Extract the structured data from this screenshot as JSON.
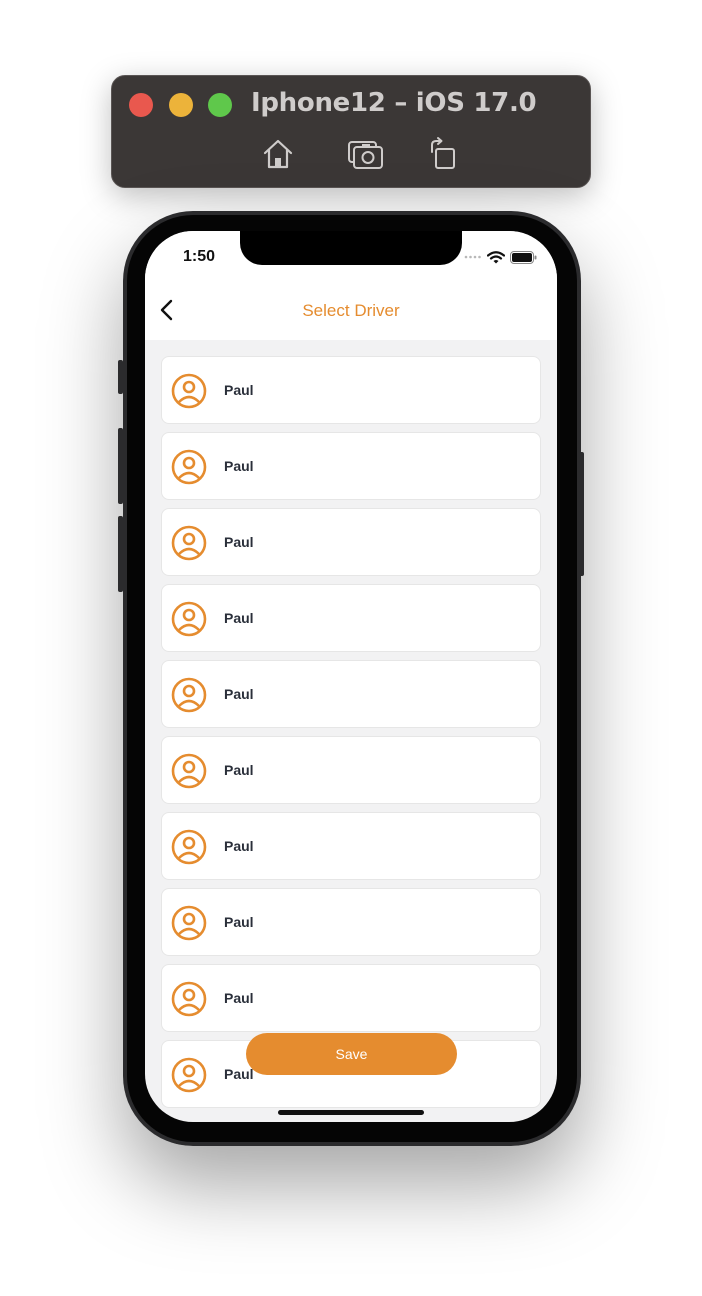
{
  "simulator": {
    "title": "Iphone12 – iOS 17.0",
    "buttons": [
      "home-icon",
      "screenshot-icon",
      "rotate-icon"
    ]
  },
  "status_bar": {
    "time": "1:50"
  },
  "header": {
    "title": "Select Driver",
    "back_icon": "chevron-left-icon"
  },
  "drivers": [
    {
      "name": "Paul"
    },
    {
      "name": "Paul"
    },
    {
      "name": "Paul"
    },
    {
      "name": "Paul"
    },
    {
      "name": "Paul"
    },
    {
      "name": "Paul"
    },
    {
      "name": "Paul"
    },
    {
      "name": "Paul"
    },
    {
      "name": "Paul"
    },
    {
      "name": "Paul"
    }
  ],
  "actions": {
    "save_label": "Save"
  },
  "colors": {
    "accent": "#e58c2f",
    "background": "#f2f2f3",
    "card": "#ffffff",
    "text": "#2a2f3a"
  }
}
